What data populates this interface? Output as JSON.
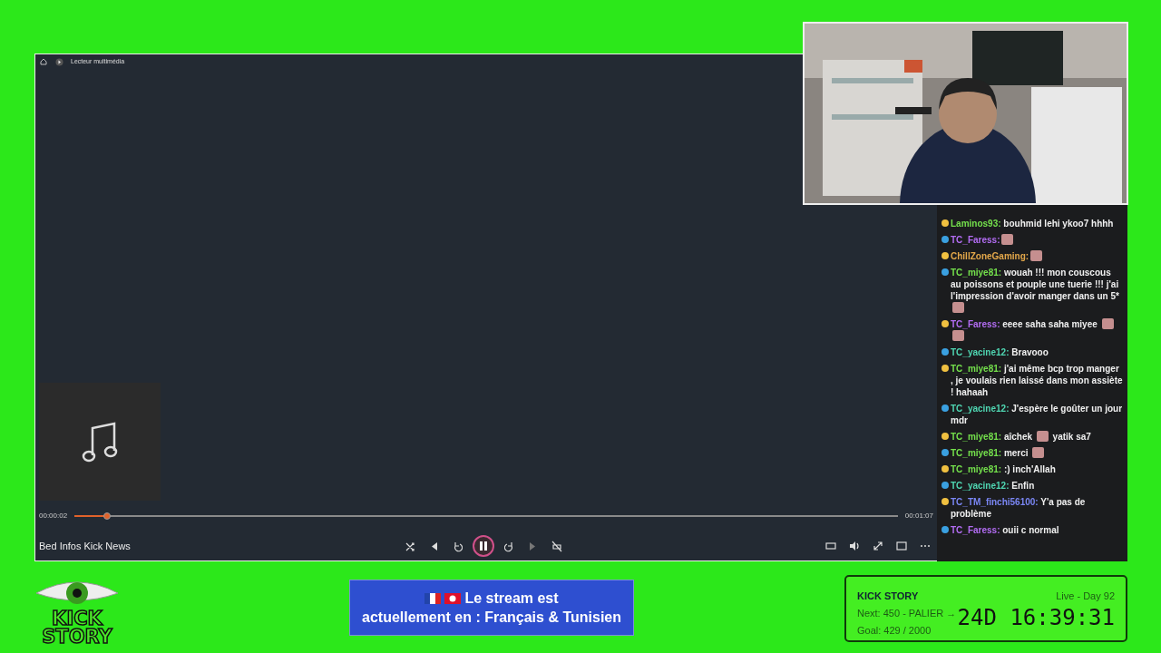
{
  "player": {
    "title": "Lecteur multimédia",
    "track": "Bed Infos Kick News",
    "elapsed": "00:00:02",
    "duration": "00:01:07",
    "level": 0.04,
    "playing": true
  },
  "chat": [
    {
      "user": "Laminos93:",
      "color": "#74e04c",
      "segments": [
        {
          "kind": "text",
          "text": "bouhmid lehi ykoo7 hhhh"
        }
      ]
    },
    {
      "user": "TC_Faress:",
      "color": "#b26cf2",
      "segments": [
        {
          "kind": "emote"
        }
      ]
    },
    {
      "user": "ChillZoneGaming:",
      "color": "#e4a84a",
      "segments": [
        {
          "kind": "emote"
        }
      ]
    },
    {
      "user": "TC_miye81:",
      "color": "#74e04c",
      "segments": [
        {
          "kind": "text",
          "text": "wouah !!! mon couscous au poissons et pouple une tuerie !!! j'ai l'impression d'avoir manger dans un 5*"
        },
        {
          "kind": "emote"
        }
      ]
    },
    {
      "user": "TC_Faress:",
      "color": "#b26cf2",
      "segments": [
        {
          "kind": "text",
          "text": "eeee saha saha miyee"
        },
        {
          "kind": "emote"
        },
        {
          "kind": "emote"
        }
      ]
    },
    {
      "user": "TC_yacine12:",
      "color": "#4fd6b2",
      "segments": [
        {
          "kind": "text",
          "text": "Bravooo"
        }
      ]
    },
    {
      "user": "TC_miye81:",
      "color": "#74e04c",
      "segments": [
        {
          "kind": "text",
          "text": "j'ai même bcp trop manger , je voulais rien laissé dans mon assiète ! hahaah"
        }
      ]
    },
    {
      "user": "TC_yacine12:",
      "color": "#4fd6b2",
      "segments": [
        {
          "kind": "text",
          "text": "J'espère le goûter un jour mdr"
        }
      ]
    },
    {
      "user": "TC_miye81:",
      "color": "#74e04c",
      "segments": [
        {
          "kind": "text",
          "text": "aîchek"
        },
        {
          "kind": "emote"
        },
        {
          "kind": "text",
          "text": "yatik sa7"
        }
      ]
    },
    {
      "user": "TC_miye81:",
      "color": "#74e04c",
      "segments": [
        {
          "kind": "text",
          "text": "merci"
        },
        {
          "kind": "emote"
        }
      ]
    },
    {
      "user": "TC_miye81:",
      "color": "#74e04c",
      "segments": [
        {
          "kind": "text",
          "text": ":) inch'Allah"
        }
      ]
    },
    {
      "user": "TC_yacine12:",
      "color": "#4fd6b2",
      "segments": [
        {
          "kind": "text",
          "text": "Enfin"
        }
      ]
    },
    {
      "user": "TC_TM_finchi56100:",
      "color": "#7a86f4",
      "segments": [
        {
          "kind": "text",
          "text": "Y'a pas de problème"
        }
      ]
    },
    {
      "user": "TC_Faress:",
      "color": "#b26cf2",
      "segments": [
        {
          "kind": "text",
          "text": "ouii c normal"
        }
      ]
    }
  ],
  "logo": [
    "KICK",
    "STORY"
  ],
  "banner": {
    "lines": [
      "Le stream est",
      "actuellement en : Français & Tunisien"
    ]
  },
  "stats": {
    "title": "KICK STORY",
    "next": "Next: 450 - PALIER →",
    "goal": "Goal: 429 / 2000",
    "live": "Live - Day 92",
    "timer": "24D 16:39:31"
  }
}
